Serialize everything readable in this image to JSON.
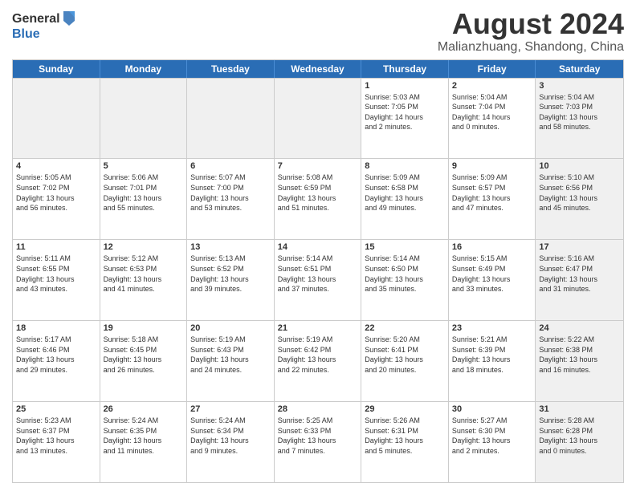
{
  "logo": {
    "general": "General",
    "blue": "Blue"
  },
  "title": "August 2024",
  "subtitle": "Malianzhuang, Shandong, China",
  "header_days": [
    "Sunday",
    "Monday",
    "Tuesday",
    "Wednesday",
    "Thursday",
    "Friday",
    "Saturday"
  ],
  "weeks": [
    [
      {
        "day": "",
        "info": "",
        "shaded": true
      },
      {
        "day": "",
        "info": "",
        "shaded": true
      },
      {
        "day": "",
        "info": "",
        "shaded": true
      },
      {
        "day": "",
        "info": "",
        "shaded": true
      },
      {
        "day": "1",
        "info": "Sunrise: 5:03 AM\nSunset: 7:05 PM\nDaylight: 14 hours\nand 2 minutes."
      },
      {
        "day": "2",
        "info": "Sunrise: 5:04 AM\nSunset: 7:04 PM\nDaylight: 14 hours\nand 0 minutes."
      },
      {
        "day": "3",
        "info": "Sunrise: 5:04 AM\nSunset: 7:03 PM\nDaylight: 13 hours\nand 58 minutes.",
        "shaded": true
      }
    ],
    [
      {
        "day": "4",
        "info": "Sunrise: 5:05 AM\nSunset: 7:02 PM\nDaylight: 13 hours\nand 56 minutes."
      },
      {
        "day": "5",
        "info": "Sunrise: 5:06 AM\nSunset: 7:01 PM\nDaylight: 13 hours\nand 55 minutes."
      },
      {
        "day": "6",
        "info": "Sunrise: 5:07 AM\nSunset: 7:00 PM\nDaylight: 13 hours\nand 53 minutes."
      },
      {
        "day": "7",
        "info": "Sunrise: 5:08 AM\nSunset: 6:59 PM\nDaylight: 13 hours\nand 51 minutes."
      },
      {
        "day": "8",
        "info": "Sunrise: 5:09 AM\nSunset: 6:58 PM\nDaylight: 13 hours\nand 49 minutes."
      },
      {
        "day": "9",
        "info": "Sunrise: 5:09 AM\nSunset: 6:57 PM\nDaylight: 13 hours\nand 47 minutes."
      },
      {
        "day": "10",
        "info": "Sunrise: 5:10 AM\nSunset: 6:56 PM\nDaylight: 13 hours\nand 45 minutes.",
        "shaded": true
      }
    ],
    [
      {
        "day": "11",
        "info": "Sunrise: 5:11 AM\nSunset: 6:55 PM\nDaylight: 13 hours\nand 43 minutes."
      },
      {
        "day": "12",
        "info": "Sunrise: 5:12 AM\nSunset: 6:53 PM\nDaylight: 13 hours\nand 41 minutes."
      },
      {
        "day": "13",
        "info": "Sunrise: 5:13 AM\nSunset: 6:52 PM\nDaylight: 13 hours\nand 39 minutes."
      },
      {
        "day": "14",
        "info": "Sunrise: 5:14 AM\nSunset: 6:51 PM\nDaylight: 13 hours\nand 37 minutes."
      },
      {
        "day": "15",
        "info": "Sunrise: 5:14 AM\nSunset: 6:50 PM\nDaylight: 13 hours\nand 35 minutes."
      },
      {
        "day": "16",
        "info": "Sunrise: 5:15 AM\nSunset: 6:49 PM\nDaylight: 13 hours\nand 33 minutes."
      },
      {
        "day": "17",
        "info": "Sunrise: 5:16 AM\nSunset: 6:47 PM\nDaylight: 13 hours\nand 31 minutes.",
        "shaded": true
      }
    ],
    [
      {
        "day": "18",
        "info": "Sunrise: 5:17 AM\nSunset: 6:46 PM\nDaylight: 13 hours\nand 29 minutes."
      },
      {
        "day": "19",
        "info": "Sunrise: 5:18 AM\nSunset: 6:45 PM\nDaylight: 13 hours\nand 26 minutes."
      },
      {
        "day": "20",
        "info": "Sunrise: 5:19 AM\nSunset: 6:43 PM\nDaylight: 13 hours\nand 24 minutes."
      },
      {
        "day": "21",
        "info": "Sunrise: 5:19 AM\nSunset: 6:42 PM\nDaylight: 13 hours\nand 22 minutes."
      },
      {
        "day": "22",
        "info": "Sunrise: 5:20 AM\nSunset: 6:41 PM\nDaylight: 13 hours\nand 20 minutes."
      },
      {
        "day": "23",
        "info": "Sunrise: 5:21 AM\nSunset: 6:39 PM\nDaylight: 13 hours\nand 18 minutes."
      },
      {
        "day": "24",
        "info": "Sunrise: 5:22 AM\nSunset: 6:38 PM\nDaylight: 13 hours\nand 16 minutes.",
        "shaded": true
      }
    ],
    [
      {
        "day": "25",
        "info": "Sunrise: 5:23 AM\nSunset: 6:37 PM\nDaylight: 13 hours\nand 13 minutes."
      },
      {
        "day": "26",
        "info": "Sunrise: 5:24 AM\nSunset: 6:35 PM\nDaylight: 13 hours\nand 11 minutes."
      },
      {
        "day": "27",
        "info": "Sunrise: 5:24 AM\nSunset: 6:34 PM\nDaylight: 13 hours\nand 9 minutes."
      },
      {
        "day": "28",
        "info": "Sunrise: 5:25 AM\nSunset: 6:33 PM\nDaylight: 13 hours\nand 7 minutes."
      },
      {
        "day": "29",
        "info": "Sunrise: 5:26 AM\nSunset: 6:31 PM\nDaylight: 13 hours\nand 5 minutes."
      },
      {
        "day": "30",
        "info": "Sunrise: 5:27 AM\nSunset: 6:30 PM\nDaylight: 13 hours\nand 2 minutes."
      },
      {
        "day": "31",
        "info": "Sunrise: 5:28 AM\nSunset: 6:28 PM\nDaylight: 13 hours\nand 0 minutes.",
        "shaded": true
      }
    ]
  ]
}
